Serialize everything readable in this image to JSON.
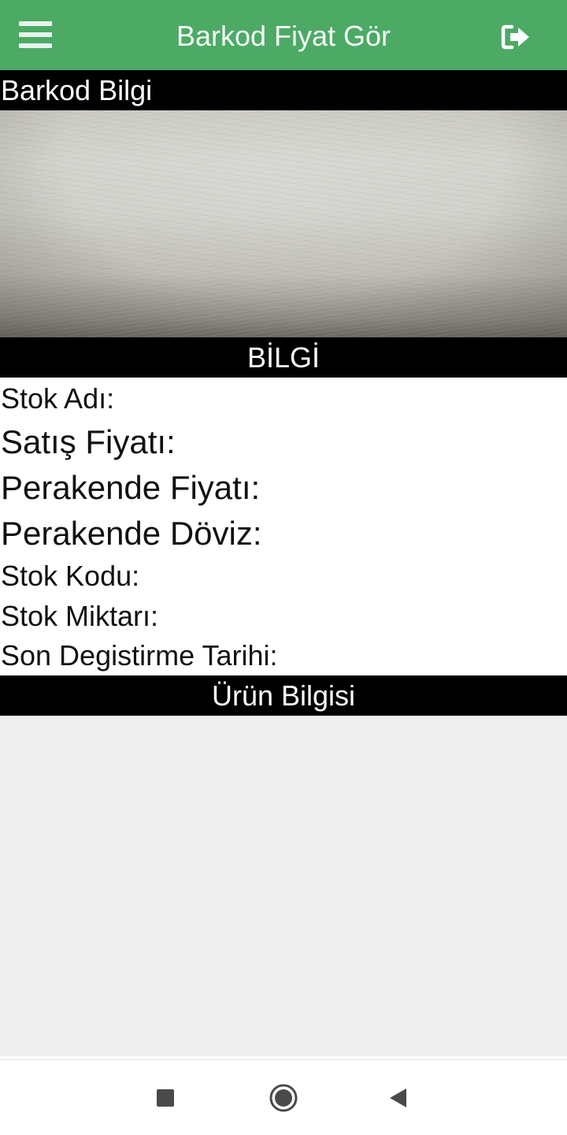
{
  "app_bar": {
    "title": "Barkod Fiyat Gör",
    "menu_icon": "hamburger-menu-icon",
    "logout_icon": "logout-icon",
    "color": "#4caa65"
  },
  "barcode_section": {
    "header": "Barkod Bilgi"
  },
  "info_section": {
    "header": "BİLGİ",
    "fields": {
      "stock_name": "Stok Adı:",
      "sale_price": "Satış Fiyatı:",
      "retail_price": "Perakende Fiyatı:",
      "retail_currency": "Perakende Döviz:",
      "stock_code": "Stok Kodu:",
      "stock_quantity": "Stok Miktarı:",
      "last_modified": "Son Degistirme Tarihi:"
    }
  },
  "product_section": {
    "header": "Ürün Bilgisi"
  },
  "navigation_bar": {
    "recent_icon": "recent-apps-icon",
    "home_icon": "home-icon",
    "back_icon": "back-icon"
  }
}
